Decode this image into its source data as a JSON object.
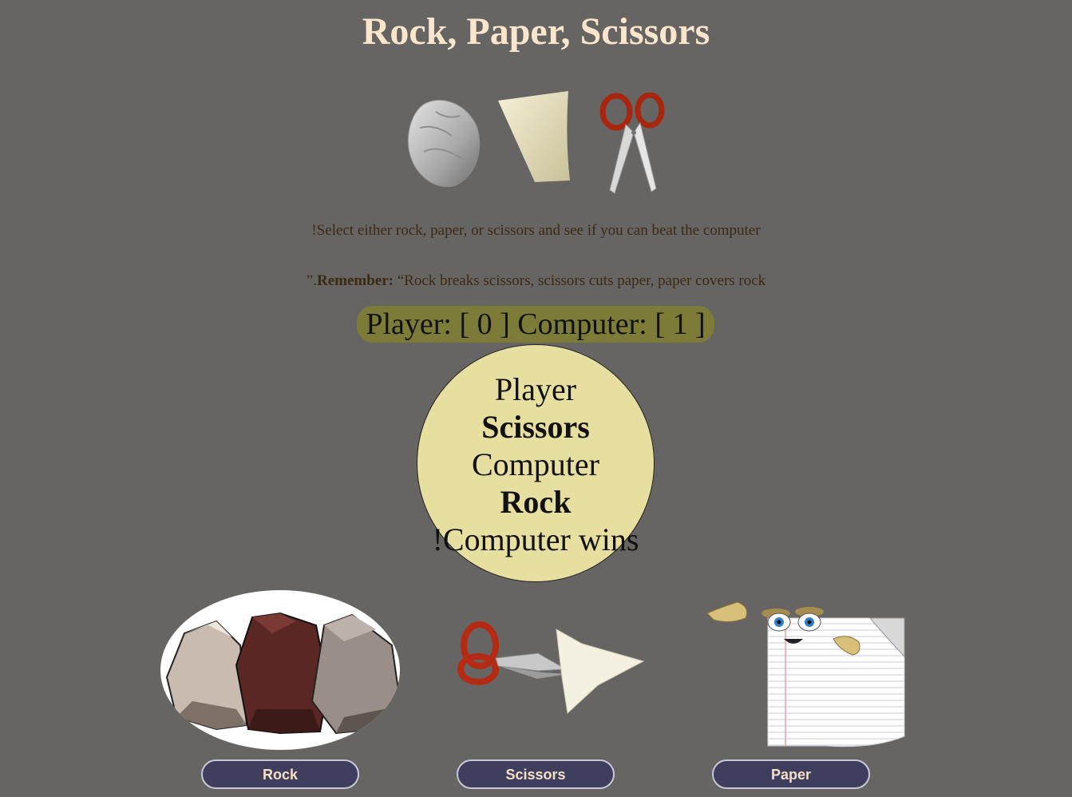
{
  "page": {
    "title": "Rock, Paper, Scissors",
    "instruction": "!Select either rock, paper, or scissors and see if you can beat the computer",
    "remember_prefix": "”.",
    "remember_label": "Remember:",
    "remember_text": " “Rock breaks scissors, scissors cuts paper, paper covers rock"
  },
  "scoreboard": {
    "text": "Player: [ 0 ] Computer: [ 1 ]"
  },
  "result": {
    "player_label": "Player",
    "player_choice": "Scissors",
    "computer_label": "Computer",
    "computer_choice": "Rock",
    "outcome": "!Computer wins"
  },
  "choices": [
    {
      "label": "Rock"
    },
    {
      "label": "Scissors"
    },
    {
      "label": "Paper"
    }
  ],
  "colors": {
    "background": "#666564",
    "title": "#fbe6cc",
    "scoreboard": "#7d7b38",
    "result_circle": "#e6df9f",
    "button": "#3f3e5e",
    "button_text": "#f5dfc6"
  }
}
